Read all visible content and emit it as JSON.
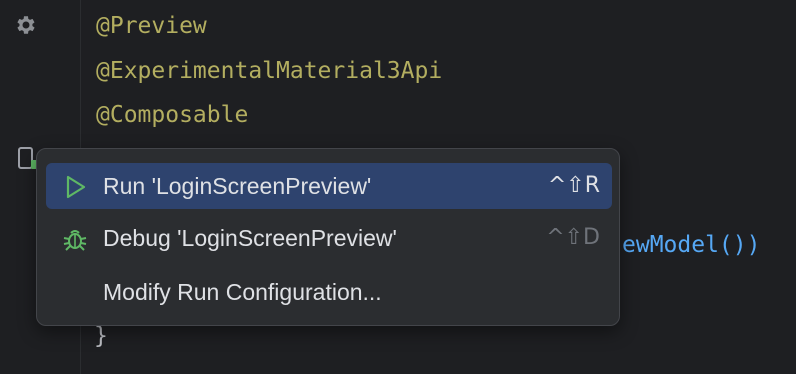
{
  "code": {
    "line1": "@Preview",
    "line2": "@ExperimentalMaterial3Api",
    "line3": "@Composable",
    "visible_fragment": "ewModel())",
    "closing_brace": "}"
  },
  "gutter": {
    "settings_icon": "gear-icon",
    "preview_icon": "device-preview-icon"
  },
  "popup": {
    "items": [
      {
        "label": "Run 'LoginScreenPreview'",
        "shortcut": "^⇧R",
        "icon": "run-icon",
        "selected": true
      },
      {
        "label": "Debug 'LoginScreenPreview'",
        "shortcut": "^⇧D",
        "icon": "debug-icon",
        "selected": false
      },
      {
        "label": "Modify Run Configuration...",
        "shortcut": "",
        "icon": "",
        "selected": false
      }
    ]
  },
  "colors": {
    "editor_bg": "#1e1f22",
    "popup_bg": "#2b2d30",
    "selection_bg": "#2e436e",
    "annotation": "#b3ae60",
    "run_green": "#5fb865"
  }
}
